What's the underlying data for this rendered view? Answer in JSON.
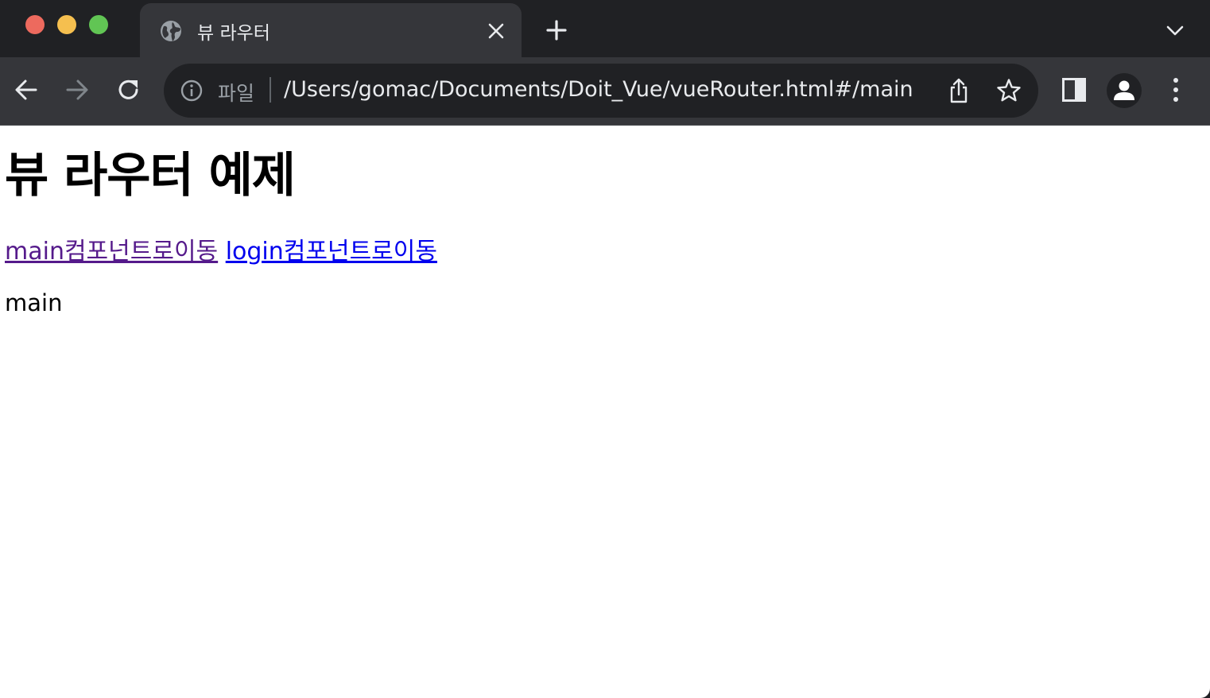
{
  "window": {
    "tab": {
      "title": "뷰 라우터",
      "favicon": "globe-icon"
    }
  },
  "toolbar": {
    "omnibox": {
      "scheme_label": "파일",
      "url": "/Users/gomac/Documents/Doit_Vue/vueRouter.html#/main"
    },
    "icons": [
      "back-arrow-icon",
      "forward-arrow-icon",
      "reload-icon",
      "info-icon",
      "share-icon",
      "star-icon",
      "side-panel-icon",
      "profile-icon",
      "kebab-menu-icon"
    ]
  },
  "page": {
    "heading": "뷰 라우터 예제",
    "links": [
      {
        "label": "main컴포넌트로이동",
        "visited": true
      },
      {
        "label": "login컴포넌트로이동",
        "visited": false
      }
    ],
    "router_view": "main"
  },
  "colors": {
    "titlebar": "#202124",
    "toolbar": "#35363a",
    "visited_link": "#551a8b",
    "unvisited_link": "#0000ee",
    "traffic_close": "#ed6a5e",
    "traffic_min": "#f5bf4f",
    "traffic_max": "#61c554"
  }
}
